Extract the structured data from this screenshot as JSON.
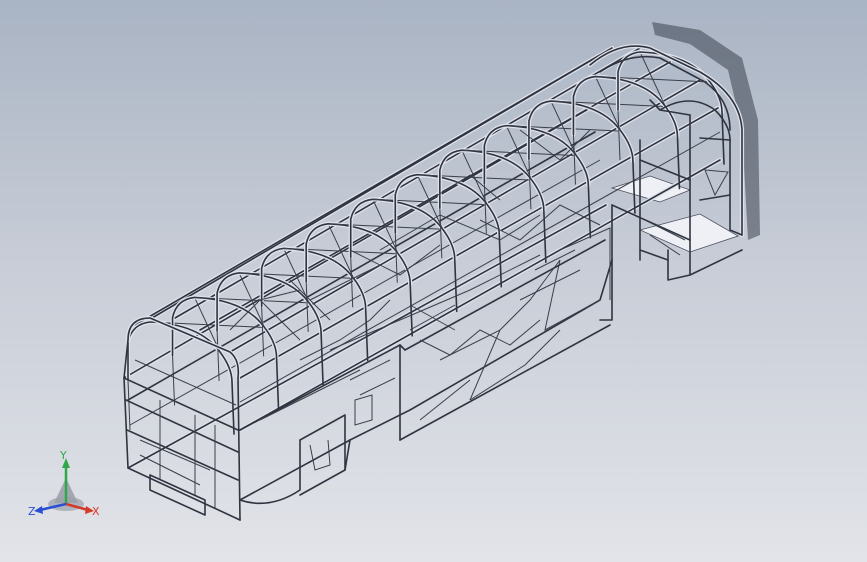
{
  "viewport": {
    "background_top": "#a9b4c4",
    "background_bottom": "#e2e4e9",
    "model_name": "bus-body-frame"
  },
  "triad": {
    "x_label": "X",
    "y_label": "Y",
    "z_label": "Z",
    "x_color": "#d43a2a",
    "y_color": "#2fa84a",
    "z_color": "#2a4fd4"
  }
}
